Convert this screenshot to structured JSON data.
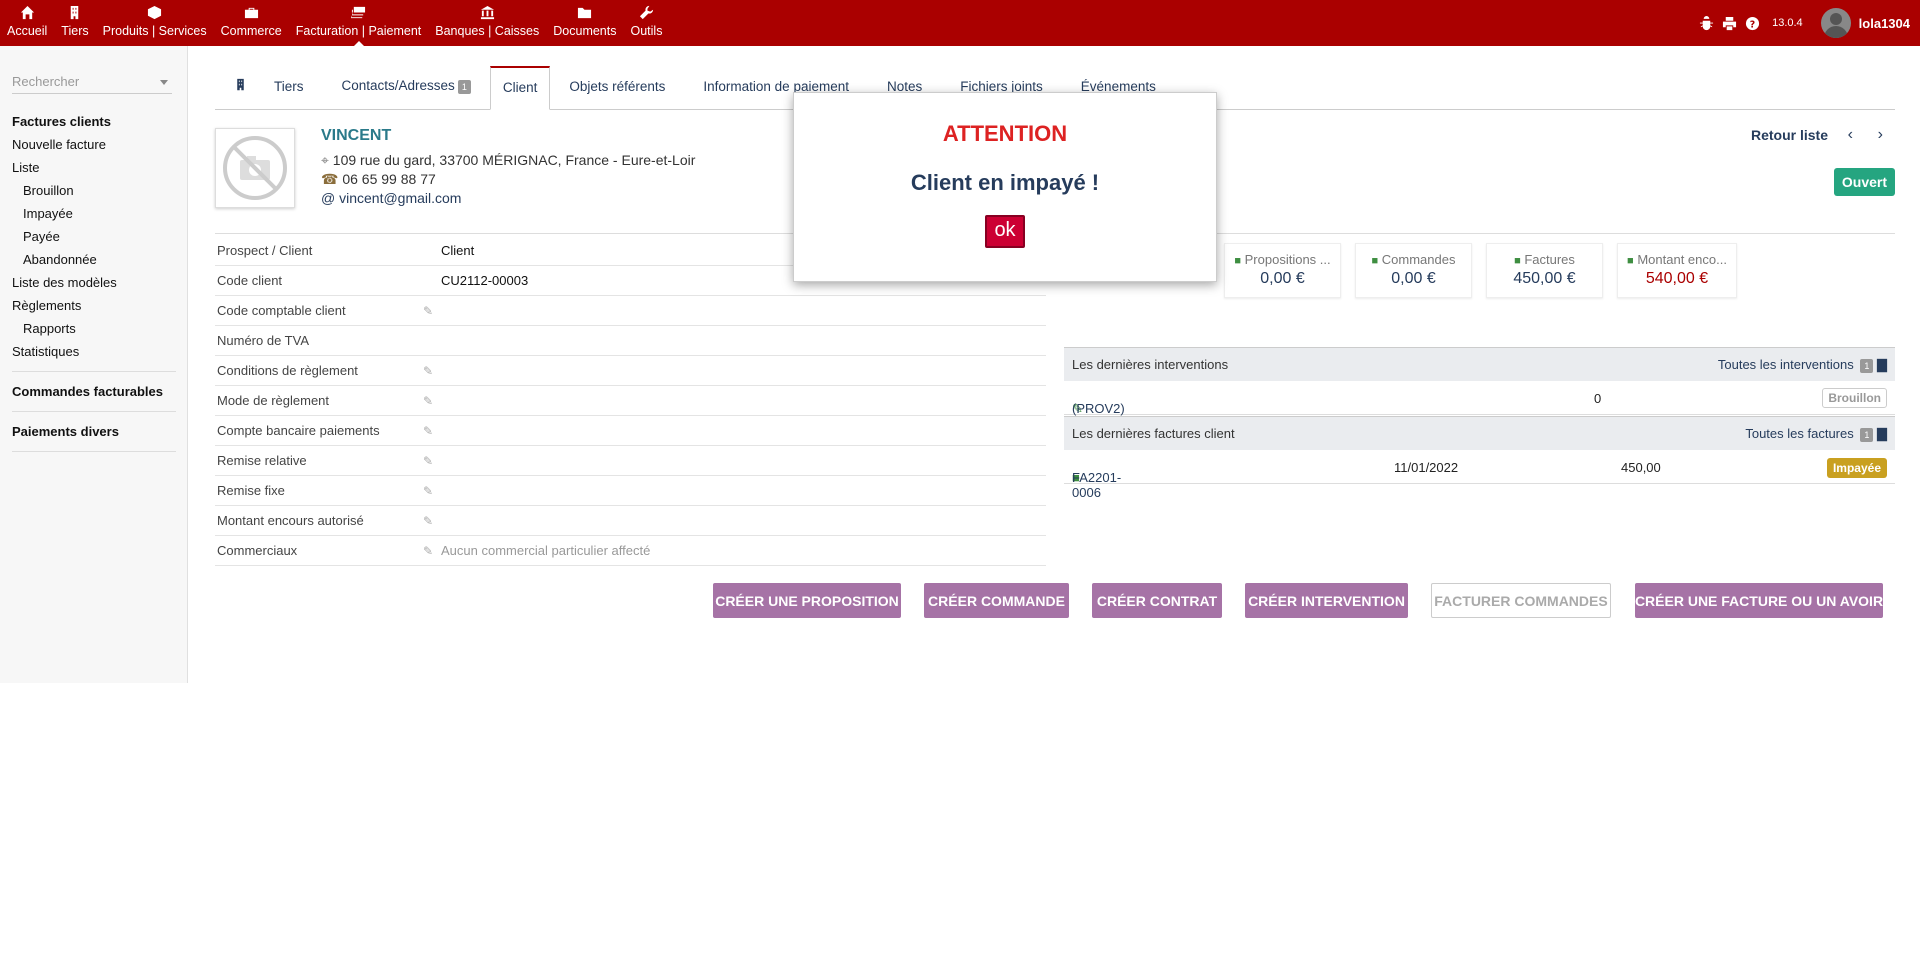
{
  "topnav": [
    {
      "label": "Accueil",
      "icon": "home-icon"
    },
    {
      "label": "Tiers",
      "icon": "building-icon"
    },
    {
      "label": "Produits | Services",
      "icon": "cube-icon"
    },
    {
      "label": "Commerce",
      "icon": "briefcase-icon"
    },
    {
      "label": "Facturation | Paiement",
      "icon": "money-icon"
    },
    {
      "label": "Banques | Caisses",
      "icon": "bank-icon"
    },
    {
      "label": "Documents",
      "icon": "folder-icon"
    },
    {
      "label": "Outils",
      "icon": "wrench-icon"
    }
  ],
  "topright": {
    "version": "13.0.4",
    "username": "lola1304"
  },
  "sidebar": {
    "search_placeholder": "Rechercher",
    "sections": {
      "factures_clients": "Factures clients",
      "nouvelle_facture": "Nouvelle facture",
      "liste": "Liste",
      "brouillon": "Brouillon",
      "impayee": "Impayée",
      "payee": "Payée",
      "abandonnee": "Abandonnée",
      "liste_modeles": "Liste des modèles",
      "reglements": "Règlements",
      "rapports": "Rapports",
      "statistiques": "Statistiques",
      "commandes_facturables": "Commandes facturables",
      "paiements_divers": "Paiements divers"
    }
  },
  "tabs": {
    "tiers": "Tiers",
    "contacts": "Contacts/Adresses",
    "contacts_count": "1",
    "client": "Client",
    "objets": "Objets référents",
    "info_paiement": "Information de paiement",
    "notes": "Notes",
    "fichiers": "Fichiers joints",
    "evenements": "Événements"
  },
  "customer": {
    "name": "VINCENT",
    "address": "109 rue du gard, 33700 MÉRIGNAC, France - Eure-et-Loir",
    "phone": "06 65 99 88 77",
    "email": "vincent@gmail.com"
  },
  "nav": {
    "retour": "Retour liste",
    "status": "Ouvert"
  },
  "fields": {
    "prospect_label": "Prospect / Client",
    "prospect_value": "Client",
    "code_client_label": "Code client",
    "code_client_value": "CU2112-00003",
    "code_comptable_label": "Code comptable client",
    "tva_label": "Numéro de TVA",
    "conditions_label": "Conditions de règlement",
    "mode_label": "Mode de règlement",
    "compte_label": "Compte bancaire paiements",
    "remise_rel_label": "Remise relative",
    "remise_fixe_label": "Remise fixe",
    "encours_label": "Montant encours autorisé",
    "commerciaux_label": "Commerciaux",
    "commerciaux_value": "Aucun commercial particulier affecté"
  },
  "stats": {
    "propositions_label": "Propositions ...",
    "propositions_value": "0,00 €",
    "commandes_label": "Commandes",
    "commandes_value": "0,00 €",
    "factures_label": "Factures",
    "factures_value": "450,00 €",
    "encours_label": "Montant enco...",
    "encours_value": "540,00 €"
  },
  "interventions": {
    "title": "Les dernières interventions",
    "all_link": "Toutes les interventions",
    "count": "1",
    "row": {
      "ref": "(PROV2)",
      "value": "0",
      "status": "Brouillon"
    }
  },
  "invoices": {
    "title": "Les dernières factures client",
    "all_link": "Toutes les factures",
    "count": "1",
    "row": {
      "ref": "FA2201-0006",
      "date": "11/01/2022",
      "amount": "450,00",
      "status": "Impayée"
    }
  },
  "actions": {
    "proposition": "CRÉER UNE PROPOSITION",
    "commande": "CRÉER COMMANDE",
    "contrat": "CRÉER CONTRAT",
    "intervention": "CRÉER INTERVENTION",
    "facturer": "FACTURER COMMANDES",
    "facture": "CRÉER UNE FACTURE OU UN AVOIR"
  },
  "modal": {
    "title": "ATTENTION",
    "message": "Client en impayé !",
    "ok": "ok"
  }
}
